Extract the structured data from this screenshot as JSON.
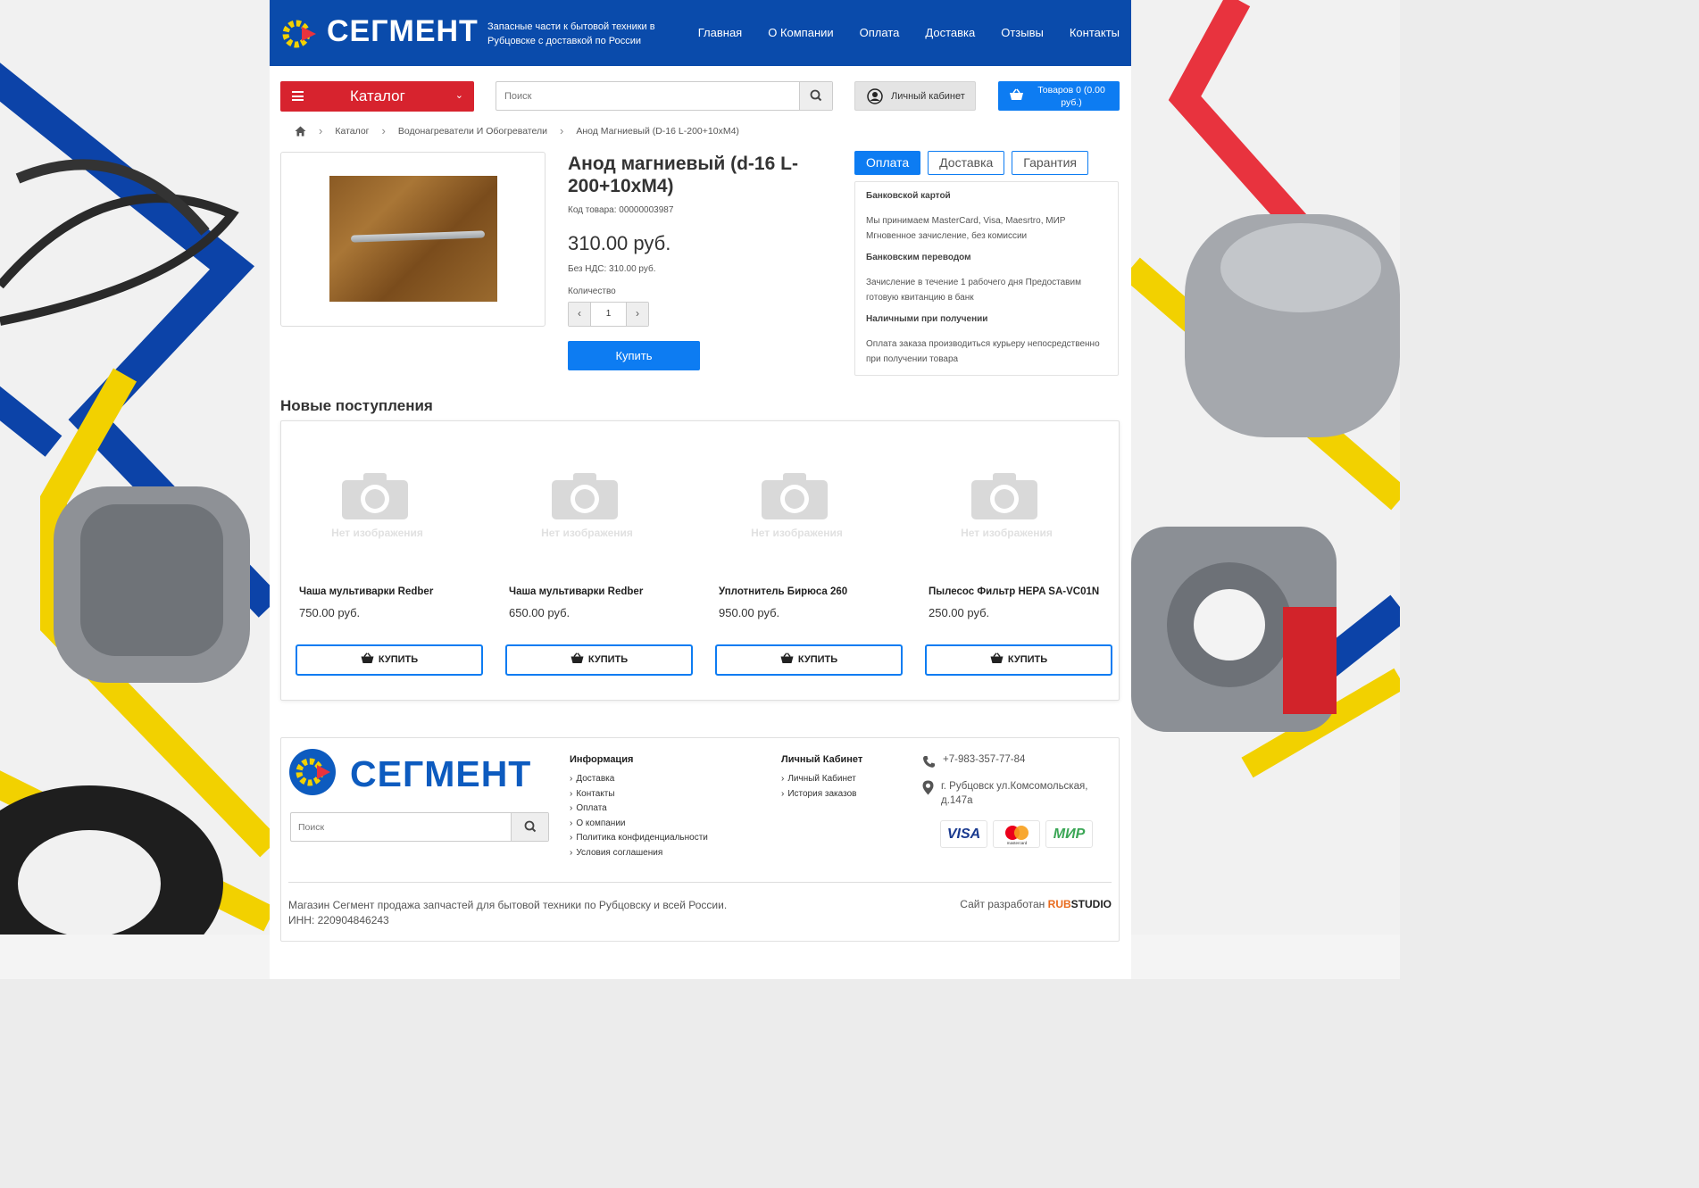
{
  "header": {
    "logo": "СЕГМЕНТ",
    "tagline": "Запасные части к бытовой техники в Рубцовске с доставкой по России",
    "nav": [
      "Главная",
      "О Компании",
      "Оплата",
      "Доставка",
      "Отзывы",
      "Контакты"
    ]
  },
  "toolbar": {
    "catalog_label": "Каталог",
    "search_placeholder": "Поиск",
    "account_label": "Личный кабинет",
    "cart_label": "Товаров 0 (0.00 руб.)"
  },
  "breadcrumb": [
    "Каталог",
    "Водонагреватели И Обогреватели",
    "Анод Магниевый (D-16 L-200+10хМ4)"
  ],
  "product": {
    "title": "Анод магниевый (d-16 L-200+10хМ4)",
    "code": "Код товара: 00000003987",
    "price": "310.00 руб.",
    "vat": "Без НДС: 310.00 руб.",
    "qty_label": "Количество",
    "qty": "1",
    "buy_label": "Купить"
  },
  "tabs": {
    "items": [
      "Оплата",
      "Доставка",
      "Гарантия"
    ],
    "active": "Оплата",
    "panel": [
      {
        "heading": "Банковской картой",
        "text": "Мы принимаем MasterCard, Visa, Maesrtro, МИР Мгновенное зачисление, без комиссии"
      },
      {
        "heading": "Банковским переводом",
        "text": "Зачисление в течение 1 рабочего дня Предоставим готовую квитанцию в банк"
      },
      {
        "heading": "Наличными при получении",
        "text": "Оплата заказа производиться курьеру непосредственно при получении товара"
      }
    ]
  },
  "new_arrivals": {
    "title": "Новые поступления",
    "no_image_label": "Нет изображения",
    "buy_label": "КУПИТЬ",
    "items": [
      {
        "name": "Чаша мультиварки Redber",
        "price": "750.00 руб."
      },
      {
        "name": "Чаша мультиварки Redber",
        "price": "650.00 руб."
      },
      {
        "name": "Уплотнитель Бирюса 260",
        "price": "950.00 руб."
      },
      {
        "name": "Пылесос Фильтр HEPA SA-VC01N",
        "price": "250.00 руб."
      }
    ]
  },
  "footer": {
    "logo": "СЕГМЕНТ",
    "search_placeholder": "Поиск",
    "info_title": "Информация",
    "info_links": [
      "Доставка",
      "Контакты",
      "Оплата",
      "О компании",
      "Политика конфиденциальности",
      "Условия соглашения"
    ],
    "account_title": "Личный Кабинет",
    "account_links": [
      "Личный Кабинет",
      "История заказов"
    ],
    "phone": "+7-983-357-77-84",
    "address": "г. Рубцовск ул.Комсомольская, д.147а",
    "payments": [
      "VISA",
      "mastercard",
      "МИР"
    ],
    "description": "Магазин Сегмент продажа запчастей для бытовой техники по Рубцовску и всей России.",
    "inn": "ИНН: 220904846243",
    "dev_prefix": "Сайт разработан",
    "dev_rub": "RUB",
    "dev_studio": "STUDIO"
  },
  "colors": {
    "header_blue": "#0a4bab",
    "accent_blue": "#0d7cf2",
    "catalog_red": "#d7232e",
    "brand_yellow": "#f2d100"
  }
}
